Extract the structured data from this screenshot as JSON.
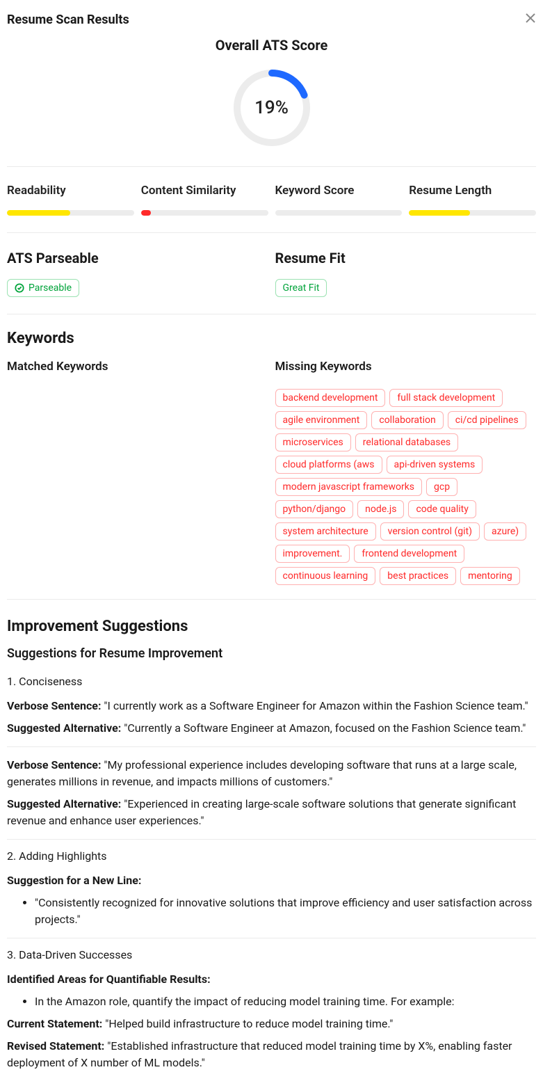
{
  "header": {
    "title": "Resume Scan Results"
  },
  "overall": {
    "label": "Overall ATS Score",
    "percent": 19,
    "percent_text": "19%"
  },
  "metrics": [
    {
      "label": "Readability",
      "percent": 50,
      "color": "yellow"
    },
    {
      "label": "Content Similarity",
      "percent": 8,
      "color": "red"
    },
    {
      "label": "Keyword Score",
      "percent": 0,
      "color": "none"
    },
    {
      "label": "Resume Length",
      "percent": 48,
      "color": "yellow"
    }
  ],
  "status": {
    "parseable": {
      "label": "ATS Parseable",
      "badge": "Parseable",
      "icon": "check"
    },
    "fit": {
      "label": "Resume Fit",
      "badge": "Great Fit"
    }
  },
  "keywords": {
    "section_label": "Keywords",
    "matched_label": "Matched Keywords",
    "missing_label": "Missing Keywords",
    "matched": [],
    "missing": [
      "backend development",
      "full stack development",
      "agile environment",
      "collaboration",
      "ci/cd pipelines",
      "microservices",
      "relational databases",
      "cloud platforms (aws",
      "api-driven systems",
      "modern javascript frameworks",
      "gcp",
      "python/django",
      "node.js",
      "code quality",
      "system architecture",
      "version control (git)",
      "azure)",
      "improvement.",
      "frontend development",
      "continuous learning",
      "best practices",
      "mentoring"
    ]
  },
  "suggestions": {
    "title": "Improvement Suggestions",
    "subtitle": "Suggestions for Resume Improvement",
    "groups": [
      {
        "heading": "1. Conciseness",
        "items": [
          {
            "pairs": [
              {
                "label": "Verbose Sentence:",
                "text": "\"I currently work as a Software Engineer for Amazon within the Fashion Science team.\""
              },
              {
                "label": "Suggested Alternative:",
                "text": "\"Currently a Software Engineer at Amazon, focused on the Fashion Science team.\""
              }
            ]
          },
          {
            "pairs": [
              {
                "label": "Verbose Sentence:",
                "text": "\"My professional experience includes developing software that runs at a large scale, generates millions in revenue, and impacts millions of customers.\""
              },
              {
                "label": "Suggested Alternative:",
                "text": "\"Experienced in creating large-scale software solutions that generate significant revenue and enhance user experiences.\""
              }
            ]
          }
        ]
      },
      {
        "heading": "2. Adding Highlights",
        "items": [
          {
            "pairs": [
              {
                "label": "Suggestion for a New Line:",
                "text": ""
              }
            ],
            "bullets": [
              "\"Consistently recognized for innovative solutions that improve efficiency and user satisfaction across projects.\""
            ]
          }
        ]
      },
      {
        "heading": "3. Data-Driven Successes",
        "items": [
          {
            "pairs": [
              {
                "label": "Identified Areas for Quantifiable Results:",
                "text": ""
              }
            ],
            "bullets": [
              "In the Amazon role, quantify the impact of reducing model training time. For example:"
            ],
            "post_pairs": [
              {
                "label": "Current Statement:",
                "text": "\"Helped build infrastructure to reduce model training time.\""
              },
              {
                "label": "Revised Statement:",
                "text": "\"Established infrastructure that reduced model training time by X%, enabling faster deployment of X number of ML models.\""
              }
            ]
          }
        ]
      }
    ]
  }
}
